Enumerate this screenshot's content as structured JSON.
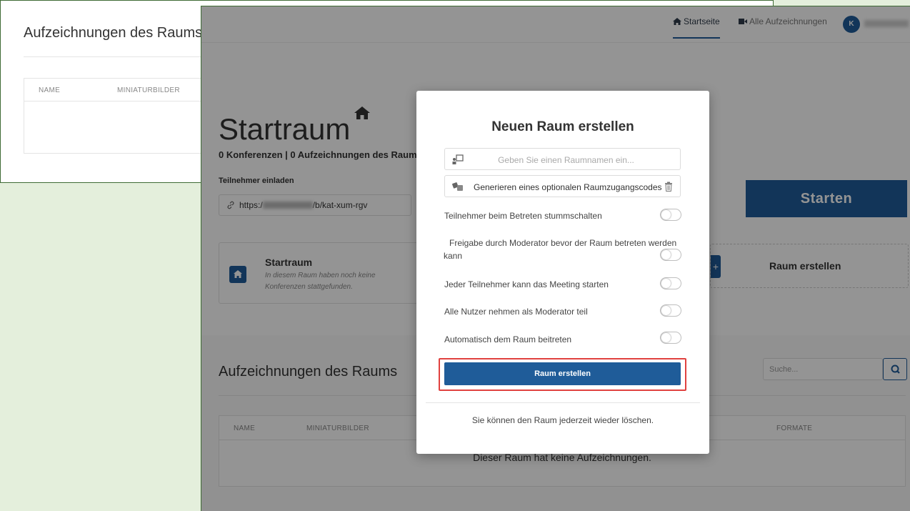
{
  "background_window": {
    "title": "Aufzeichnungen des Raums",
    "columns": [
      "NAME",
      "MINIATURBILDER"
    ]
  },
  "navbar": {
    "home_label": "Startseite",
    "recordings_label": "Alle Aufzeichnungen",
    "avatar_initial": "K"
  },
  "page": {
    "title": "Startraum",
    "stats": "0 Konferenzen | 0 Aufzeichnungen des Raum",
    "invite_label": "Teilnehmer einladen",
    "invite_url_prefix": "https:/",
    "invite_url_suffix": "/b/kat-xum-rgv",
    "start_button": "Starten"
  },
  "room_card": {
    "name": "Startraum",
    "description": "In diesem Raum haben noch keine Konferenzen stattgefunden."
  },
  "create_card": {
    "plus": "+",
    "label": "Raum erstellen"
  },
  "recordings": {
    "title": "Aufzeichnungen des Raums",
    "search_placeholder": "Suche...",
    "columns": [
      "NAME",
      "MINIATURBILDER",
      "FORMATE"
    ],
    "empty_text": "Dieser Raum hat keine Aufzeichnungen."
  },
  "modal": {
    "title": "Neuen Raum erstellen",
    "room_name_placeholder": "Geben Sie einen Raumnamen ein...",
    "access_code_label": "Generieren eines optionalen Raumzugangscodes",
    "options": [
      {
        "label": "Teilnehmer beim Betreten stummschalten",
        "on": false
      },
      {
        "label": "Freigabe durch Moderator bevor der Raum betreten werden kann",
        "on": false
      },
      {
        "label": "Jeder Teilnehmer kann das Meeting starten",
        "on": false
      },
      {
        "label": "Alle Nutzer nehmen als Moderator teil",
        "on": false
      },
      {
        "label": "Automatisch dem Raum beitreten",
        "on": false
      }
    ],
    "create_button": "Raum erstellen",
    "footer": "Sie können den Raum jederzeit wieder löschen."
  },
  "colors": {
    "primary": "#1f5c99",
    "highlight": "#e0413f",
    "desktop": "#e4efdc"
  }
}
